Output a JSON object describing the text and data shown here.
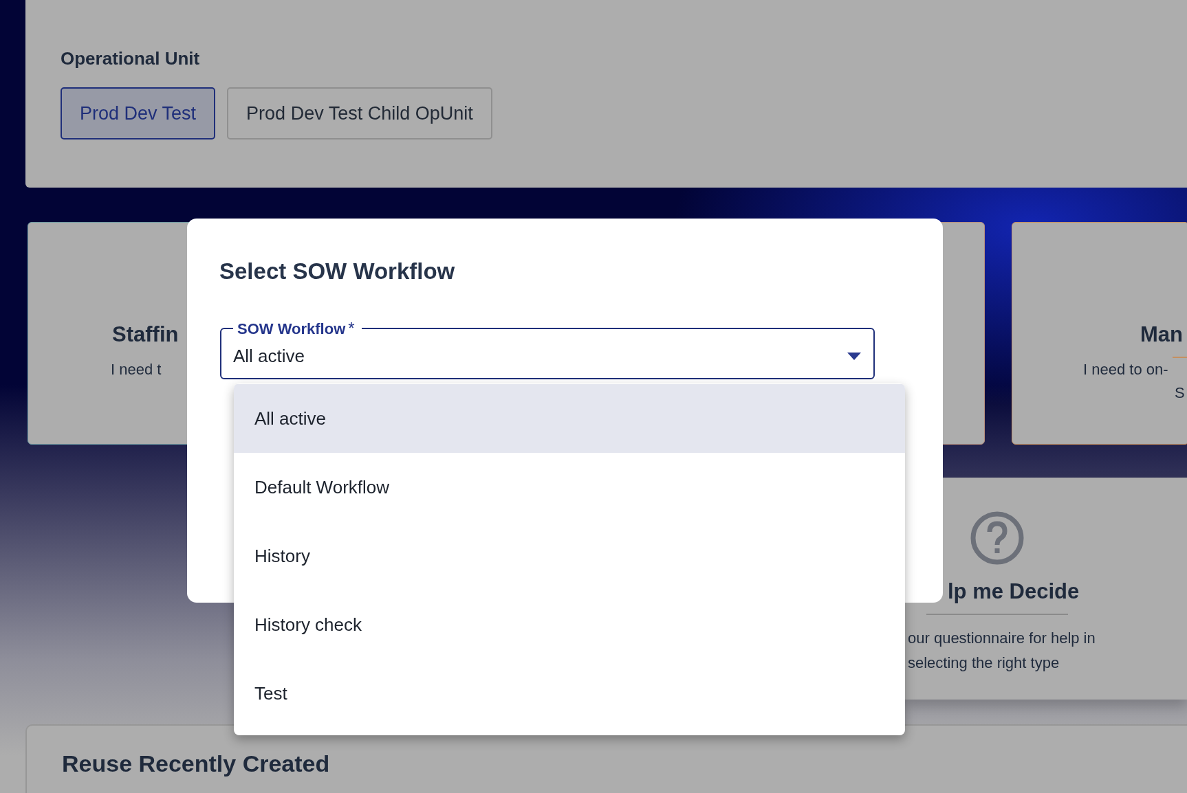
{
  "operational_unit": {
    "label": "Operational Unit",
    "options": [
      {
        "label": "Prod Dev Test",
        "selected": true
      },
      {
        "label": "Prod Dev Test Child OpUnit",
        "selected": false
      }
    ]
  },
  "cards": [
    {
      "title": "Staffin",
      "description": [
        "I need t"
      ],
      "color": "#6e9ca4",
      "underline": false
    },
    {
      "color": "#b8907e",
      "underline": false
    },
    {
      "title": "Man",
      "description": [
        "I need to on-",
        "S"
      ],
      "color": "#c69060",
      "underline": true
    }
  ],
  "help": {
    "title": "lp me Decide",
    "description": [
      "our questionnaire for help in",
      "selecting the right type"
    ]
  },
  "reuse": {
    "title": "Reuse Recently Created"
  },
  "dialog": {
    "title": "Select SOW Workflow",
    "field": {
      "label": "SOW Workflow",
      "required_mark": "*",
      "value": "All active"
    },
    "options": [
      {
        "label": "All active",
        "selected": true
      },
      {
        "label": "Default Workflow",
        "selected": false
      },
      {
        "label": "History",
        "selected": false
      },
      {
        "label": "History check",
        "selected": false
      },
      {
        "label": "Test",
        "selected": false
      }
    ]
  }
}
